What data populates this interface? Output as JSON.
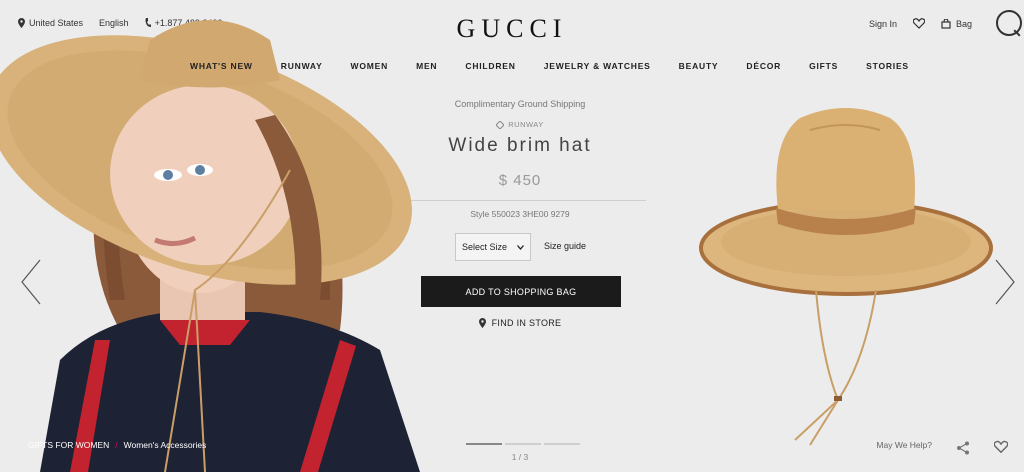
{
  "header": {
    "location": "United States",
    "language": "English",
    "phone": "+1.877.482.2430",
    "logo": "GUCCI",
    "sign_in": "Sign In",
    "bag": "Bag"
  },
  "nav": [
    "WHAT'S NEW",
    "RUNWAY",
    "WOMEN",
    "MEN",
    "CHILDREN",
    "JEWELRY & WATCHES",
    "BEAUTY",
    "DÉCOR",
    "GIFTS",
    "STORIES"
  ],
  "product": {
    "shipping": "Complimentary Ground Shipping",
    "tag": "RUNWAY",
    "title": "Wide brim hat",
    "price": "$ 450",
    "style": "Style 550023 3HE00 9279",
    "size_select": "Select Size",
    "size_guide": "Size guide",
    "add_to_bag": "ADD TO SHOPPING BAG",
    "find_in_store": "FIND IN STORE"
  },
  "footer": {
    "crumb_1": "GIFTS FOR WOMEN",
    "crumb_2": "Women's Accessories",
    "pager": "1 / 3",
    "help": "May We Help?"
  },
  "carousel": {
    "current": 1,
    "total": 3
  },
  "icons": [
    "location-pin-icon",
    "phone-icon",
    "heart-icon",
    "bag-icon",
    "search-icon",
    "chevron-left-icon",
    "chevron-right-icon",
    "share-icon",
    "diamond-icon"
  ]
}
